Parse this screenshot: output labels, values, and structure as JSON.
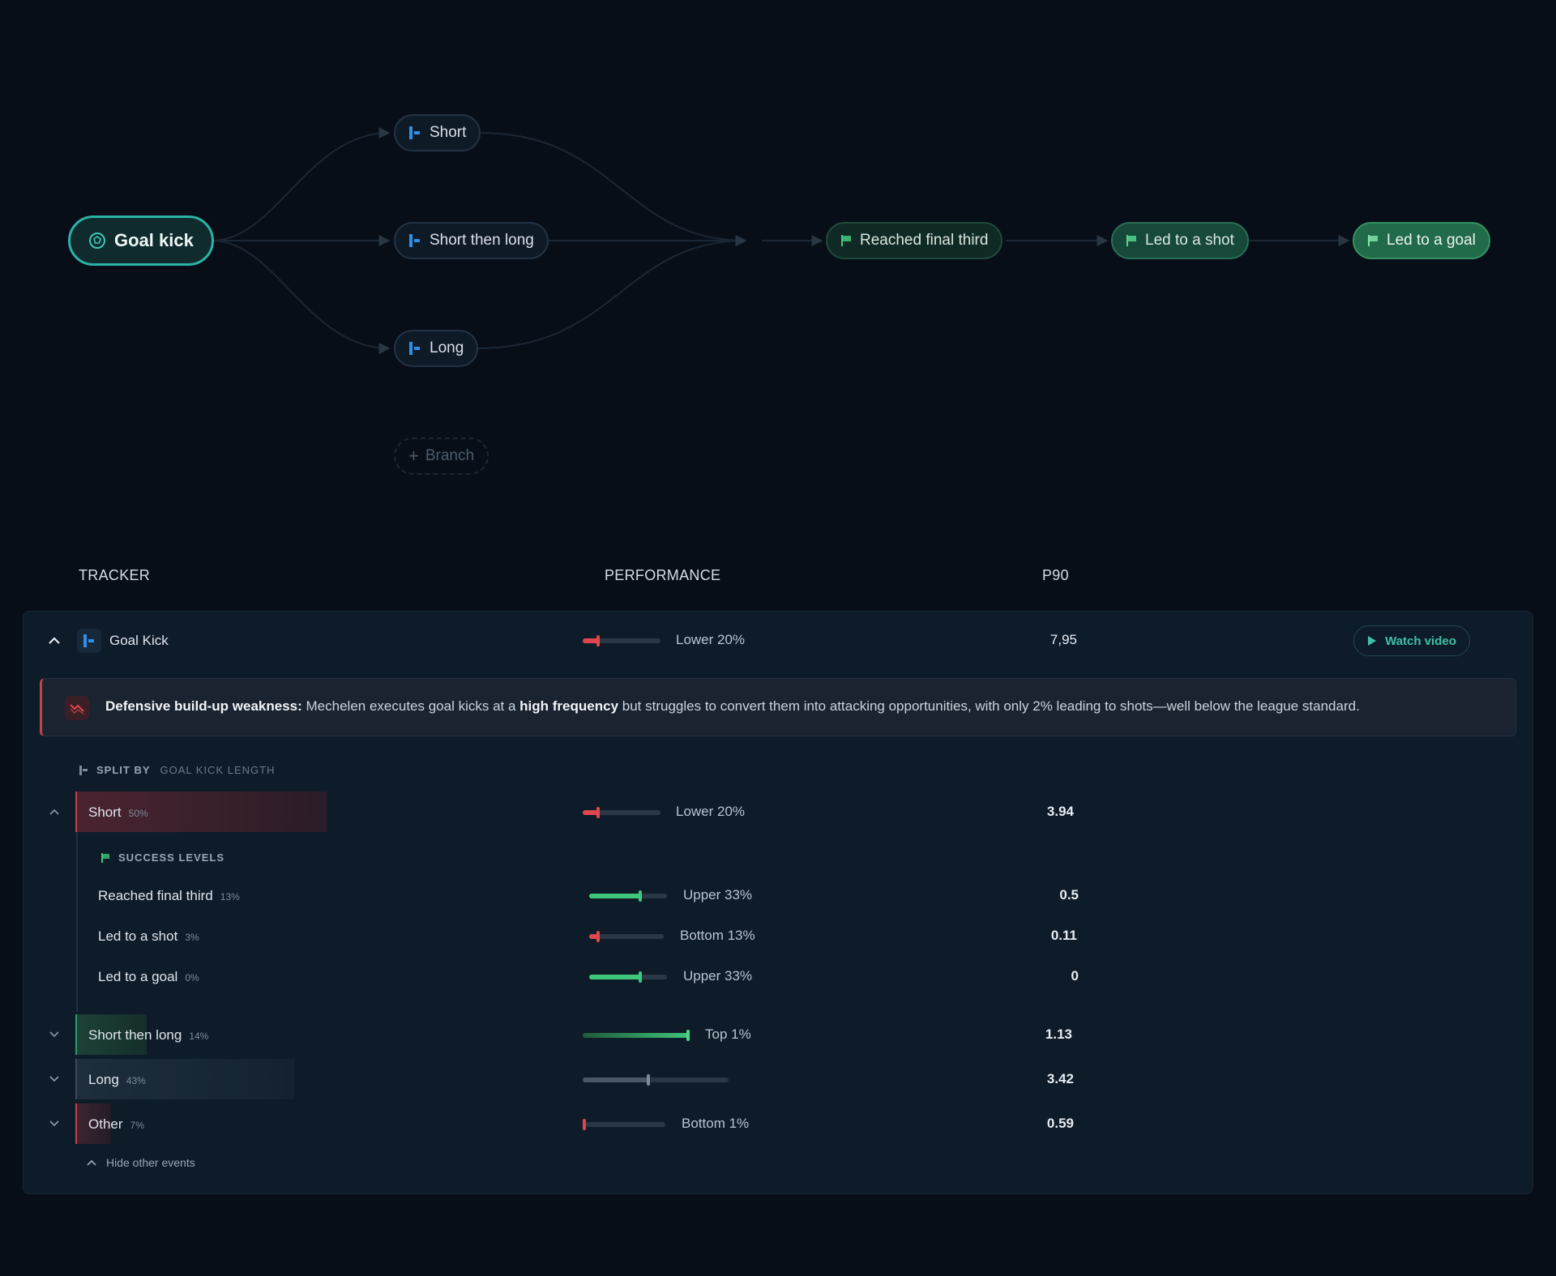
{
  "flow": {
    "start": "Goal kick",
    "branches": [
      "Short",
      "Short then long",
      "Long"
    ],
    "add_branch": "Branch",
    "success_levels": [
      "Reached final third",
      "Led to a shot",
      "Led to a goal"
    ]
  },
  "table": {
    "headers": {
      "tracker": "TRACKER",
      "performance": "PERFORMANCE",
      "p90": "P90"
    },
    "tracker": {
      "name": "Goal Kick",
      "performance": "Lower 20%",
      "p90": "7,95",
      "watch_label": "Watch video"
    },
    "alert": {
      "title": "Defensive build-up weakness:",
      "text_1": " Mechelen executes goal kicks at a ",
      "highlight": "high frequency",
      "text_2": " but struggles to convert them into attacking opportunities, with only 2% leading to shots—well below the league standard."
    },
    "split": {
      "label": "SPLIT BY",
      "value": "GOAL KICK LENGTH"
    },
    "success_heading": "SUCCESS LEVELS",
    "categories": [
      {
        "name": "Short",
        "share": "50%",
        "performance": "Lower 20%",
        "p90": "3.94",
        "level": 0.2,
        "tone": "red"
      },
      {
        "name": "Short then long",
        "share": "14%",
        "performance": "Top 1%",
        "p90": "1.13",
        "level": 0.99,
        "tone": "green"
      },
      {
        "name": "Long",
        "share": "43%",
        "performance": "",
        "p90": "3.42",
        "level": 0.45,
        "tone": "gray"
      },
      {
        "name": "Other",
        "share": "7%",
        "performance": "Bottom 1%",
        "p90": "0.59",
        "level": 0.01,
        "tone": "red"
      }
    ],
    "levels": [
      {
        "name": "Reached final third",
        "share": "13%",
        "performance": "Upper 33%",
        "p90": "0.5",
        "level": 0.67,
        "tone": "green"
      },
      {
        "name": "Led to a shot",
        "share": "3%",
        "performance": "Bottom 13%",
        "p90": "0.11",
        "level": 0.13,
        "tone": "red"
      },
      {
        "name": "Led to a goal",
        "share": "0%",
        "performance": "Upper 33%",
        "p90": "0",
        "level": 0.67,
        "tone": "green"
      }
    ],
    "hide_label": "Hide other events"
  },
  "colors": {
    "red": "#e0474c",
    "green": "#3fc77b",
    "gray": "#6b7886",
    "accent": "#2bb3a4"
  }
}
